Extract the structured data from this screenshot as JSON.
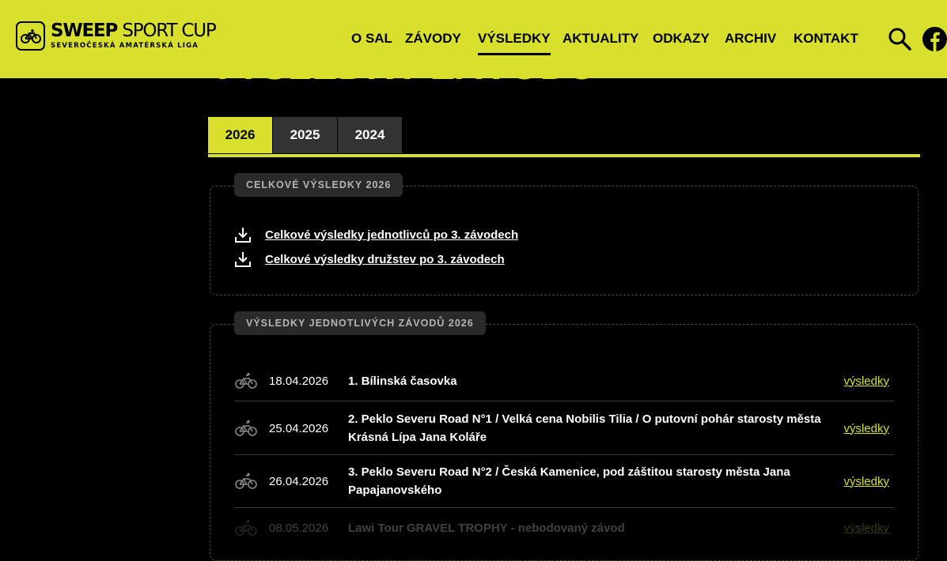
{
  "header": {
    "logo_main_bold": "SWEEP",
    "logo_main_thin": " SPORT CUP",
    "logo_sub": "SEVEROČESKÁ AMATÉRSKÁ LIGA",
    "nav": [
      "O SAL",
      "ZÁVODY",
      "VÝSLEDKY",
      "AKTUALITY",
      "ODKAZY",
      "ARCHIV",
      "KONTAKT"
    ],
    "active_nav": "VÝSLEDKY"
  },
  "page": {
    "title": "VÝSLEDKY ZÁVODŮ"
  },
  "tabs": [
    "2026",
    "2025",
    "2024"
  ],
  "overall": {
    "label": "CELKOVÉ VÝSLEDKY 2026",
    "links": [
      "Celkové výsledky jednotlivců po 3. závodech",
      "Celkové výsledky družstev po 3. závodech"
    ]
  },
  "races": {
    "label": "VÝSLEDKY JEDNOTLIVÝCH ZÁVODŮ 2026",
    "results_label": "výsledky",
    "rows": [
      {
        "date": "18.04.2026",
        "name": "1. Bílinská časovka"
      },
      {
        "date": "25.04.2026",
        "name": "2. Peklo Severu Road N°1 / Velká cena Nobilis Tilia / O putovní pohár starosty města Krásná Lípa Jana Koláře"
      },
      {
        "date": "26.04.2026",
        "name": "3. Peklo Severu Road N°2 / Česká Kamenice, pod záštitou starosty města Jana Papajanovského"
      },
      {
        "date": "08.05.2026",
        "name": "Lawi Tour GRAVEL TROPHY - nebodovaný závod"
      }
    ]
  },
  "colors": {
    "accent": "#d8df2c",
    "background": "#000000"
  }
}
